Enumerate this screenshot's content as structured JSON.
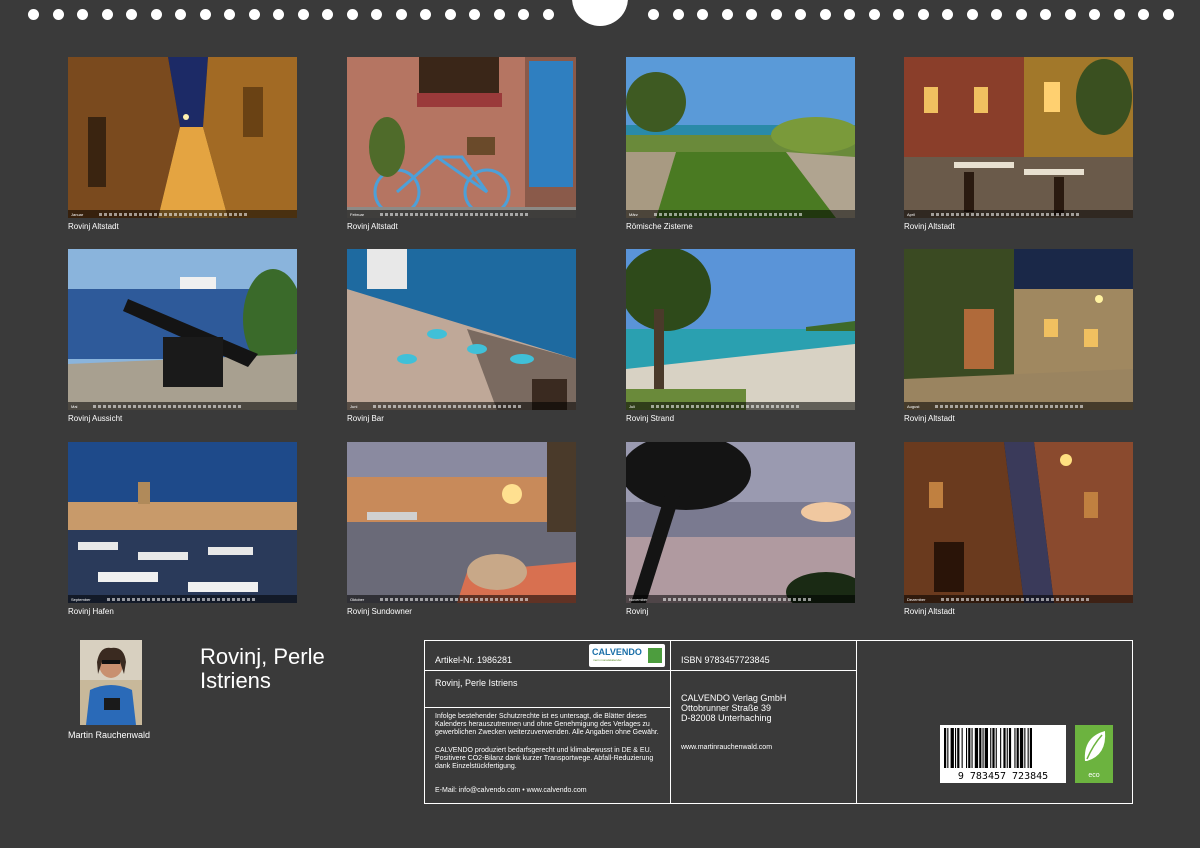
{
  "calendar": {
    "title": "Rovinj, Perle Istriens",
    "author": "Martin Rauchenwald"
  },
  "photos": [
    {
      "caption": "Rovinj Altstadt",
      "month": "Januar",
      "scene": "alley-night"
    },
    {
      "caption": "Rovinj Altstadt",
      "month": "Februar",
      "scene": "bicycle"
    },
    {
      "caption": "Römische Zisterne",
      "month": "März",
      "scene": "cistern"
    },
    {
      "caption": "Rovinj Altstadt",
      "month": "April",
      "scene": "terrace"
    },
    {
      "caption": "Rovinj Aussicht",
      "month": "Mai",
      "scene": "cannon"
    },
    {
      "caption": "Rovinj Bar",
      "month": "Juni",
      "scene": "bar"
    },
    {
      "caption": "Rovinj Strand",
      "month": "Juli",
      "scene": "beach"
    },
    {
      "caption": "Rovinj Altstadt",
      "month": "August",
      "scene": "street-night"
    },
    {
      "caption": "Rovinj Hafen",
      "month": "September",
      "scene": "harbour"
    },
    {
      "caption": "Rovinj Sundowner",
      "month": "Oktober",
      "scene": "sunset"
    },
    {
      "caption": "Rovinj",
      "month": "November",
      "scene": "tree-sunset"
    },
    {
      "caption": "Rovinj Altstadt",
      "month": "Dezember",
      "scene": "lane-lamps"
    }
  ],
  "info": {
    "article": "Artikel-Nr. 1986281",
    "logo_text": "CALVENDO",
    "logo_sub": "mein monatskalender",
    "subtitle": "Rovinj, Perle Istriens",
    "legal1": "Infolge bestehender Schutzrechte ist es untersagt, die Blätter dieses Kalenders herauszutrennen und ohne Genehmigung des Verlages zu gewerblichen Zwecken weiterzuverwenden. Alle Angaben ohne Gewähr.",
    "legal2": "CALVENDO produziert bedarfsgerecht und klimabewusst in DE & EU. Positivere CO2-Bilanz dank kurzer Transportwege. Abfall-Reduzierung dank Einzelstückfertigung.",
    "contact": "E-Mail: info@calvendo.com • www.calvendo.com",
    "isbn": "ISBN 9783457723845",
    "publisher_name": "CALVENDO Verlag GmbH",
    "publisher_street": "Ottobrunner Straße 39",
    "publisher_city": "D-82008 Unterhaching",
    "website": "www.martinrauchenwald.com",
    "barcode_digits": "9 783457 723845",
    "eco_label": "eco"
  },
  "colors": {
    "background": "#3a3a3a",
    "eco_green": "#6cb33f",
    "logo_blue": "#1a6fa8"
  }
}
